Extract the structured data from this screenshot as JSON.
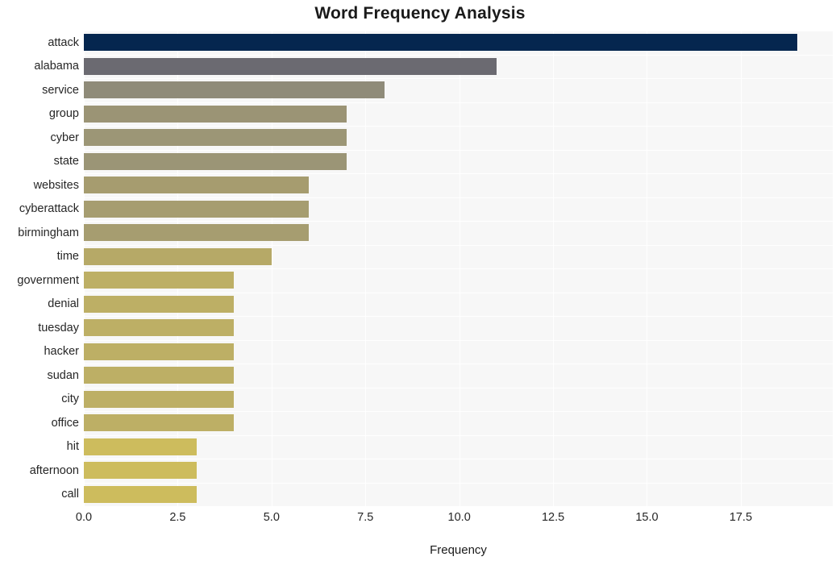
{
  "chart_data": {
    "type": "bar",
    "orientation": "horizontal",
    "title": "Word Frequency Analysis",
    "xlabel": "Frequency",
    "ylabel": "",
    "categories": [
      "attack",
      "alabama",
      "service",
      "group",
      "cyber",
      "state",
      "websites",
      "cyberattack",
      "birmingham",
      "time",
      "government",
      "denial",
      "tuesday",
      "hacker",
      "sudan",
      "city",
      "office",
      "hit",
      "afternoon",
      "call"
    ],
    "values": [
      19,
      11,
      8,
      7,
      7,
      7,
      6,
      6,
      6,
      5,
      4,
      4,
      4,
      4,
      4,
      4,
      4,
      3,
      3,
      3
    ],
    "bar_colors": [
      "#05264f",
      "#6b6a71",
      "#8f8b79",
      "#9b9475",
      "#9c9676",
      "#9b9576",
      "#a69c6f",
      "#a69d70",
      "#a69d70",
      "#b6a967",
      "#bdaf65",
      "#bdaf65",
      "#bdaf65",
      "#bdaf65",
      "#bdaf65",
      "#bdaf65",
      "#bdaf65",
      "#cdbc5d",
      "#cdbc5d",
      "#cdbc5d"
    ],
    "xlim": [
      0,
      19.95
    ],
    "ylim": [
      0,
      20
    ],
    "xticks": [
      0.0,
      2.5,
      5.0,
      7.5,
      10.0,
      12.5,
      15.0,
      17.5
    ],
    "xtick_labels": [
      "0.0",
      "2.5",
      "5.0",
      "7.5",
      "10.0",
      "12.5",
      "15.0",
      "17.5"
    ],
    "grid": true,
    "grid_color": "#ffffff",
    "plot_background": "#f7f7f7",
    "figure_background": "#ffffff",
    "legend": null
  }
}
